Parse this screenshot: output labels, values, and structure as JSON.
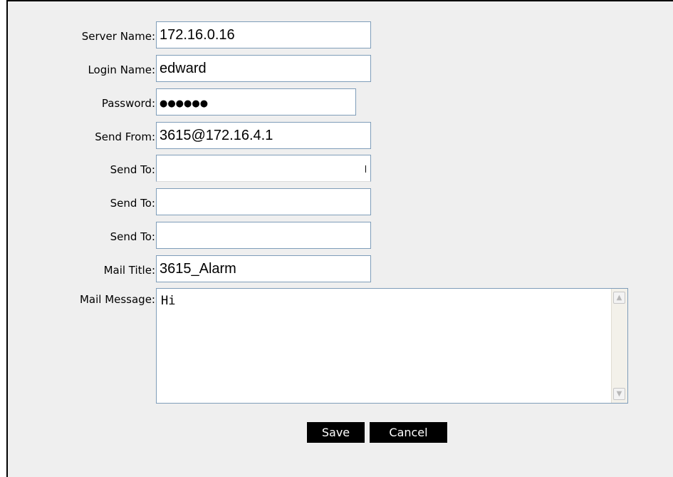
{
  "form": {
    "server_name": {
      "label": "Server Name:",
      "value": "172.16.0.16"
    },
    "login_name": {
      "label": "Login Name:",
      "value": "edward"
    },
    "password": {
      "label": "Password:",
      "value": "●●●●●●"
    },
    "send_from": {
      "label": "Send From:",
      "value": "3615@172.16.4.1"
    },
    "send_to_1": {
      "label": "Send To:",
      "value": ""
    },
    "send_to_2": {
      "label": "Send To:",
      "value": ""
    },
    "send_to_3": {
      "label": "Send To:",
      "value": ""
    },
    "mail_title": {
      "label": "Mail Title:",
      "value": "3615_Alarm"
    },
    "mail_message": {
      "label": "Mail Message:",
      "value": "Hi"
    }
  },
  "buttons": {
    "save_label": "Save",
    "cancel_label": "Cancel"
  },
  "icons": {
    "scroll_up": "chevron-up-icon",
    "scroll_down": "chevron-down-icon"
  }
}
